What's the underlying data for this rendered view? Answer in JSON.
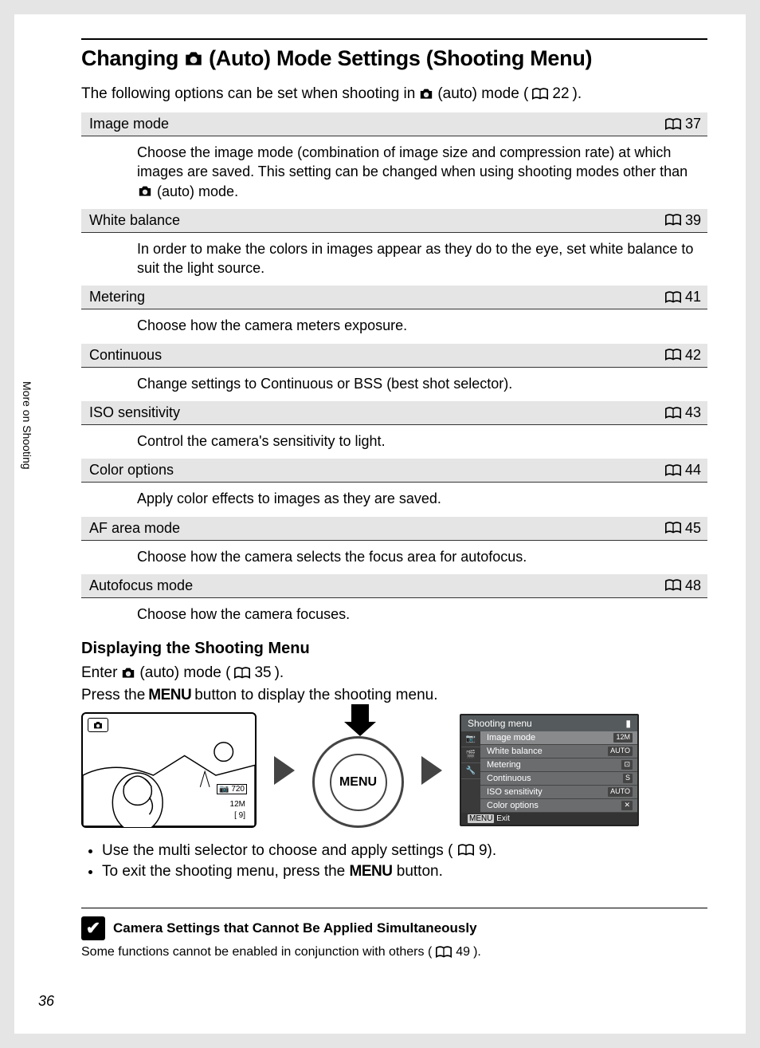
{
  "sidebar_label": "More on Shooting",
  "title_pre": "Changing",
  "title_post": "(Auto) Mode Settings (Shooting Menu)",
  "intro_pre": "The following options can be set when shooting in",
  "intro_post": "(auto) mode (",
  "intro_ref": "22",
  "intro_close": ").",
  "options": [
    {
      "name": "Image mode",
      "ref": "37",
      "desc_pre": "Choose the image mode (combination of image size and compression rate) at which images are saved. This setting can be changed when using shooting modes other than",
      "desc_post": "(auto) mode."
    },
    {
      "name": "White balance",
      "ref": "39",
      "desc_pre": "In order to make the colors in images appear as they do to the eye, set white balance to suit the light source.",
      "desc_post": ""
    },
    {
      "name": "Metering",
      "ref": "41",
      "desc_pre": "Choose how the camera meters exposure.",
      "desc_post": ""
    },
    {
      "name": "Continuous",
      "ref": "42",
      "desc_pre": "Change settings to Continuous or BSS (best shot selector).",
      "desc_post": ""
    },
    {
      "name": "ISO sensitivity",
      "ref": "43",
      "desc_pre": "Control the camera's sensitivity to light.",
      "desc_post": ""
    },
    {
      "name": "Color options",
      "ref": "44",
      "desc_pre": "Apply color effects to images as they are saved.",
      "desc_post": ""
    },
    {
      "name": "AF area mode",
      "ref": "45",
      "desc_pre": "Choose how the camera selects the focus area for autofocus.",
      "desc_post": ""
    },
    {
      "name": "Autofocus mode",
      "ref": "48",
      "desc_pre": "Choose how the camera focuses.",
      "desc_post": ""
    }
  ],
  "sub_heading": "Displaying the Shooting Menu",
  "enter_pre": "Enter",
  "enter_mid": "(auto) mode (",
  "enter_ref": "35",
  "enter_close": ").",
  "press_pre": "Press the",
  "press_menu": "MENU",
  "press_post": "button to display the shooting menu.",
  "menu_button_label": "MENU",
  "scene_badge_720": "720",
  "scene_badge_n": "12M",
  "scene_badge_b": "[   9]",
  "screen": {
    "title": "Shooting menu",
    "items": [
      {
        "label": "Image mode",
        "value": "12M"
      },
      {
        "label": "White balance",
        "value": "AUTO"
      },
      {
        "label": "Metering",
        "value": "⊡"
      },
      {
        "label": "Continuous",
        "value": "S"
      },
      {
        "label": "ISO sensitivity",
        "value": "AUTO"
      },
      {
        "label": "Color options",
        "value": "✕"
      }
    ],
    "foot_pre": "MENU",
    "foot_post": "Exit"
  },
  "bullet1_pre": "Use the multi selector to choose and apply settings (",
  "bullet1_ref": "9",
  "bullet1_close": ").",
  "bullet2_pre": "To exit the shooting menu, press the",
  "bullet2_menu": "MENU",
  "bullet2_post": "button.",
  "note_heading": "Camera Settings that Cannot Be Applied Simultaneously",
  "note_body_pre": "Some functions cannot be enabled in conjunction with others (",
  "note_body_ref": "49",
  "note_body_close": ").",
  "page_number": "36"
}
